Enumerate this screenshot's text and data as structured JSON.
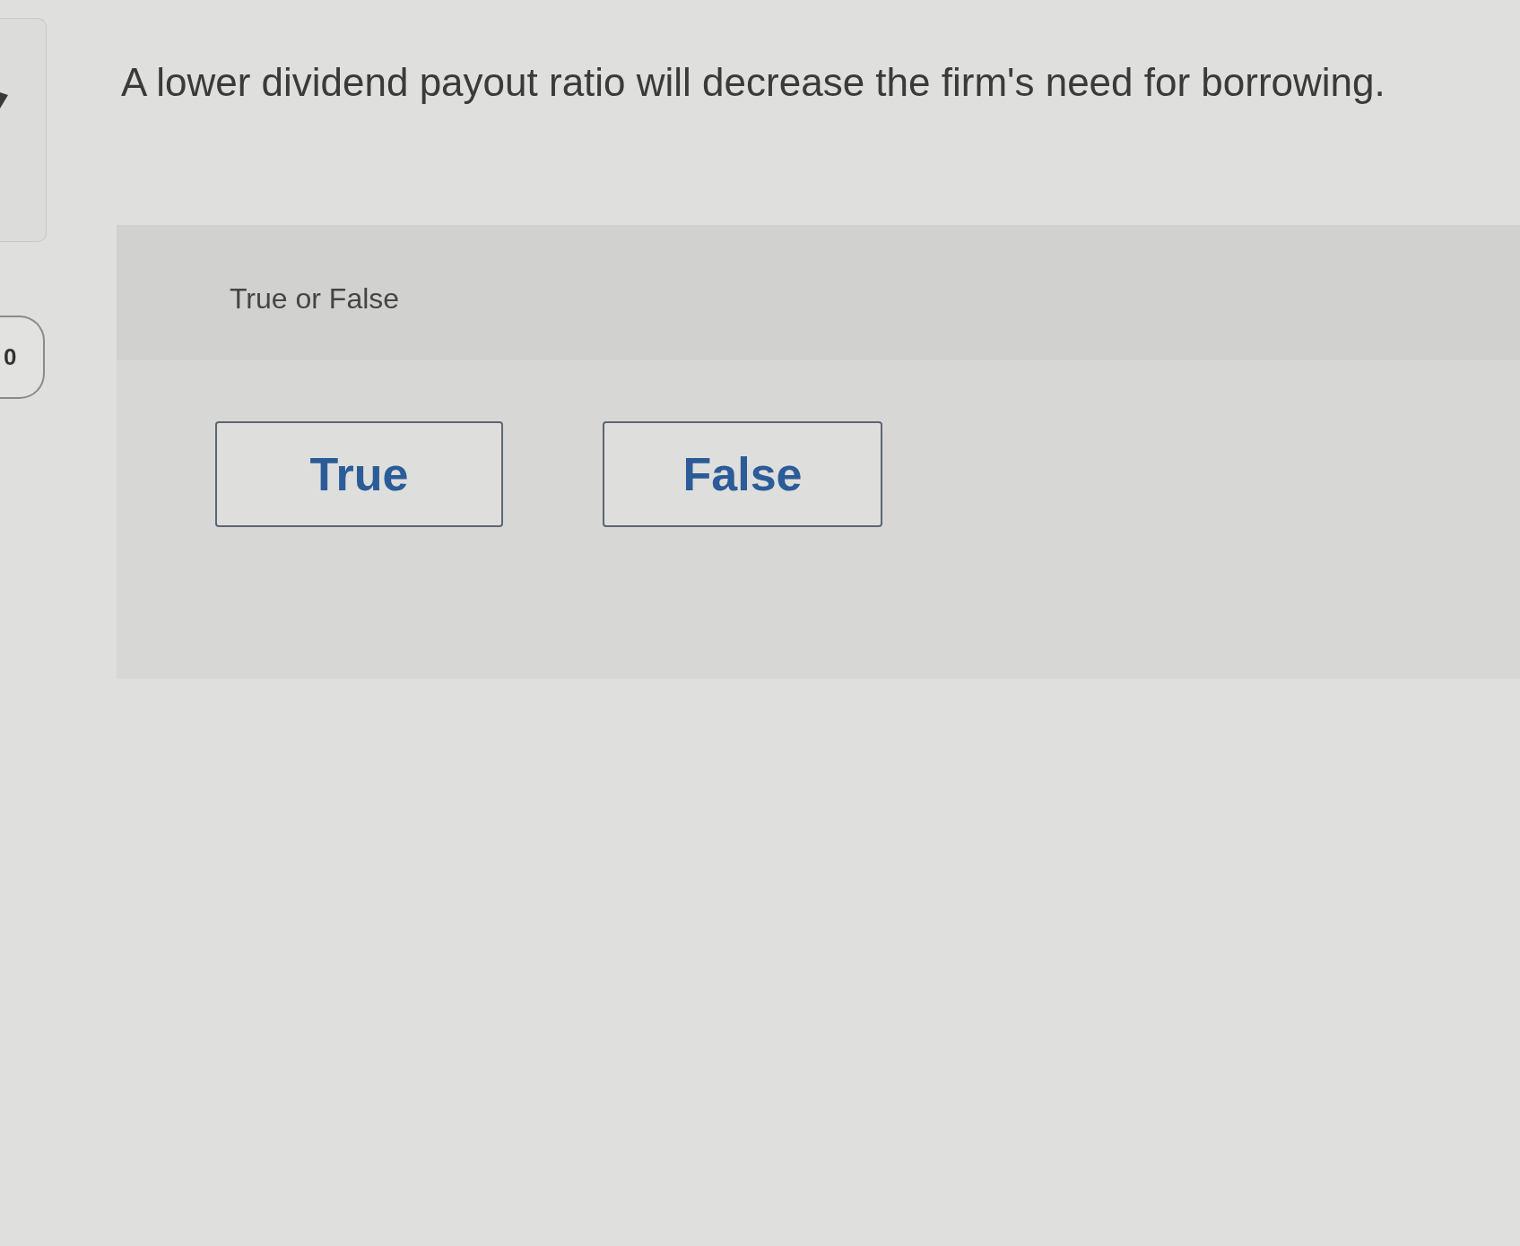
{
  "side_badge": {
    "text": "0"
  },
  "question": {
    "text": "A lower dividend payout ratio will decrease the firm's need for borrowing."
  },
  "answer_panel": {
    "heading": "True or False",
    "options": [
      {
        "label": "True",
        "selected": false
      },
      {
        "label": "False",
        "selected": false
      }
    ]
  }
}
